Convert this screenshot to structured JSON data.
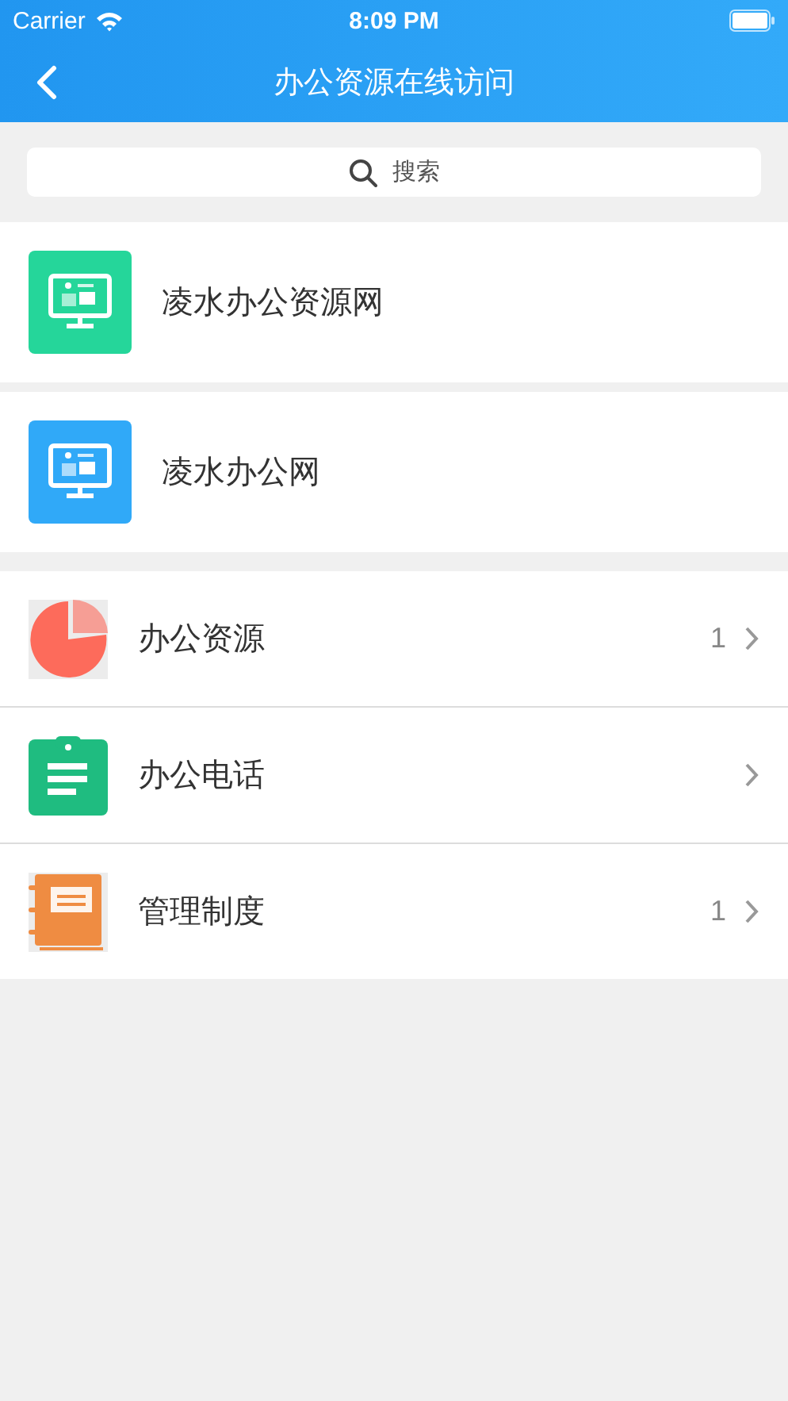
{
  "status_bar": {
    "carrier": "Carrier",
    "time": "8:09 PM"
  },
  "nav": {
    "title": "办公资源在线访问"
  },
  "search": {
    "placeholder": "搜索"
  },
  "sites": [
    {
      "label": "凌水办公资源网",
      "color": "#25d69a"
    },
    {
      "label": "凌水办公网",
      "color": "#30a9f8"
    }
  ],
  "menu": [
    {
      "kind": "pie",
      "label": "办公资源",
      "count": "1"
    },
    {
      "kind": "clipboard",
      "label": "办公电话"
    },
    {
      "kind": "notebook",
      "label": "管理制度",
      "count": "1"
    }
  ]
}
